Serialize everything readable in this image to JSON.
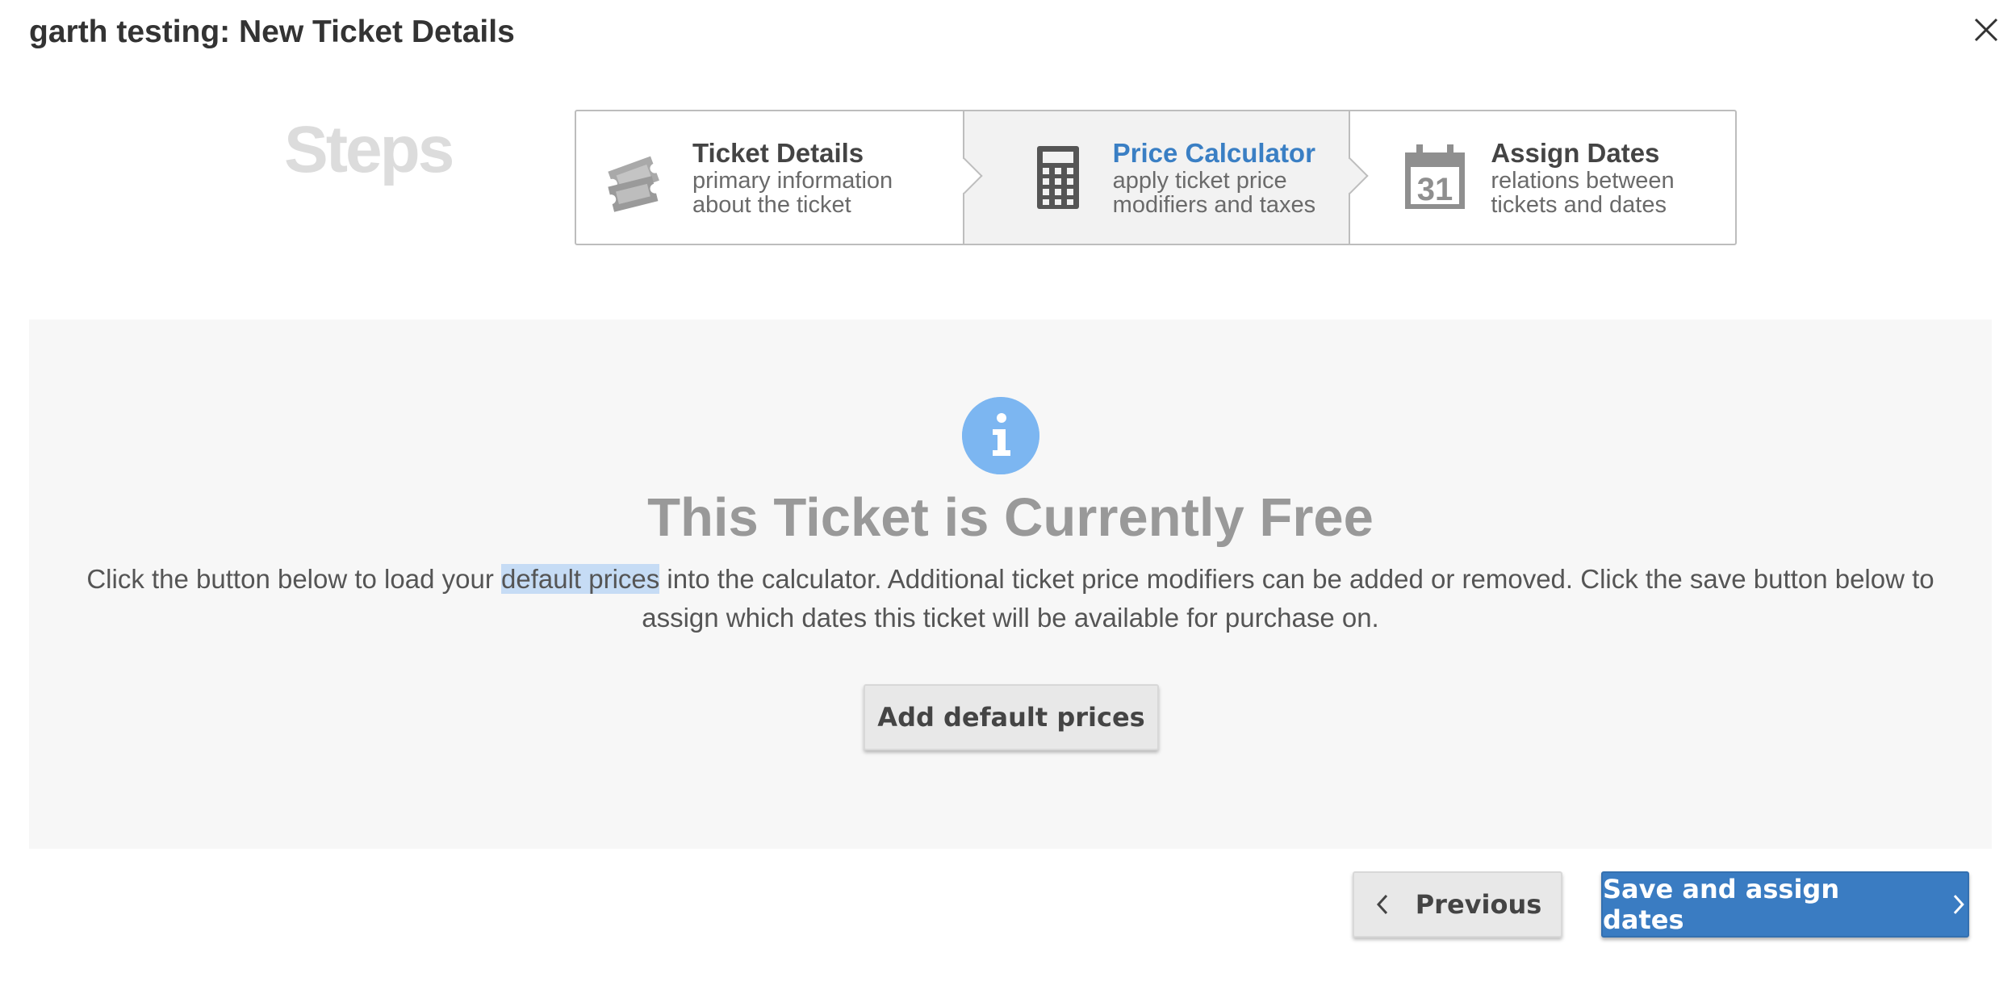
{
  "modal": {
    "title": "garth testing: New Ticket Details"
  },
  "steps": {
    "label": "Steps",
    "items": [
      {
        "title": "Ticket Details",
        "description": "primary information about the ticket",
        "icon": "tickets-icon",
        "active": false
      },
      {
        "title": "Price Calculator",
        "description": "apply ticket price modifiers and taxes",
        "icon": "calculator-icon",
        "active": true
      },
      {
        "title": "Assign Dates",
        "description": "relations between tickets and dates",
        "icon": "calendar-icon",
        "calendar_number": "31",
        "active": false
      }
    ]
  },
  "notice": {
    "icon": "info-icon",
    "heading": "This Ticket is Currently Free",
    "text_before": "Click the button below to load your ",
    "text_highlight": "default prices",
    "text_after": " into the calculator. Additional ticket price modifiers can be added or removed. Click the save button below to assign which dates this ticket will be available for purchase on.",
    "add_button": "Add default prices"
  },
  "footer": {
    "previous_label": "Previous",
    "save_label": "Save and assign dates"
  },
  "colors": {
    "accent": "#3a7cc2",
    "info": "#7cb6f1",
    "highlight": "#c6dcf5"
  }
}
